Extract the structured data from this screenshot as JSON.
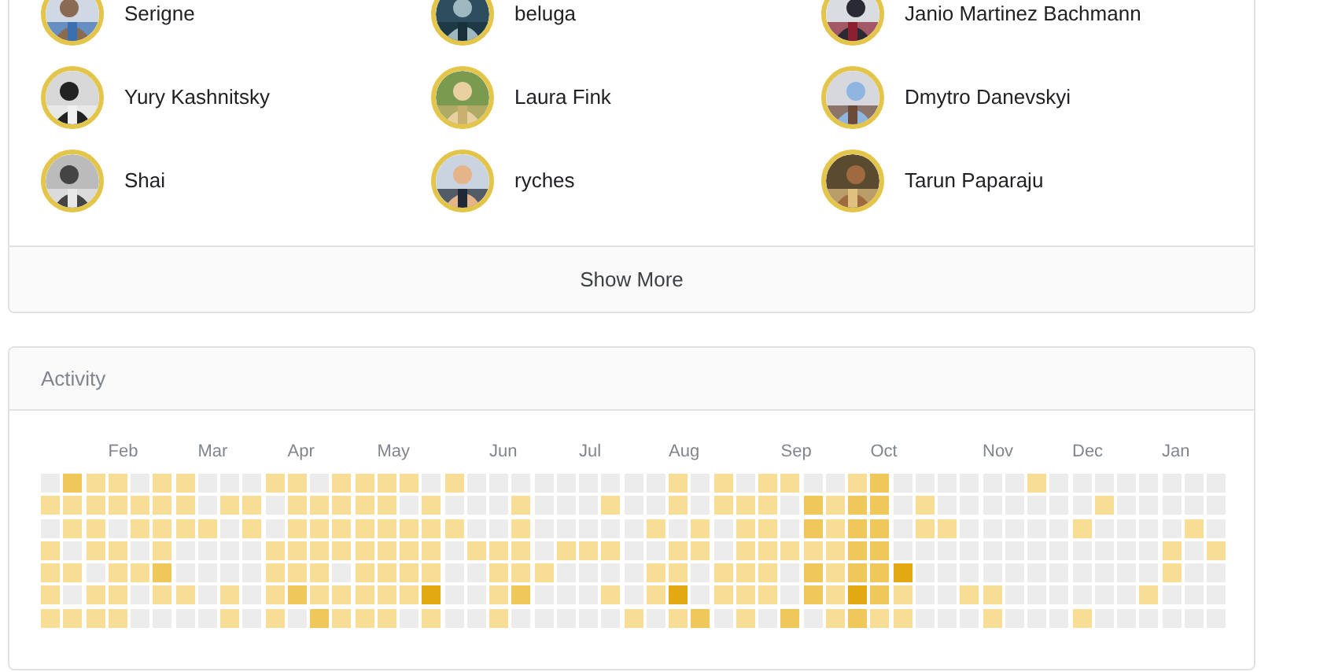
{
  "people": [
    {
      "name": "Serigne"
    },
    {
      "name": "beluga"
    },
    {
      "name": "Janio Martinez Bachmann"
    },
    {
      "name": "Yury Kashnitsky"
    },
    {
      "name": "Laura Fink"
    },
    {
      "name": "Dmytro Danevskyi"
    },
    {
      "name": "Shai"
    },
    {
      "name": "ryches"
    },
    {
      "name": "Tarun Paparaju"
    }
  ],
  "show_more": {
    "label": "Show More"
  },
  "activity": {
    "title": "Activity",
    "weeks": [
      {
        "days": [
          {
            "color": "#ececec"
          },
          {
            "color": "#f8dd97"
          },
          {
            "color": "#ececec"
          },
          {
            "color": "#f8dd97"
          },
          {
            "color": "#f8dd97"
          },
          {
            "color": "#f8dd97"
          },
          {
            "color": "#f8dd97"
          }
        ]
      },
      {
        "days": [
          {
            "color": "#f0c75a"
          },
          {
            "color": "#f8dd97"
          },
          {
            "color": "#f8dd97"
          },
          {
            "color": "#ececec"
          },
          {
            "color": "#f8dd97"
          },
          {
            "color": "#ececec"
          },
          {
            "color": "#f8dd97"
          }
        ]
      },
      {
        "days": [
          {
            "color": "#f8dd97"
          },
          {
            "color": "#f8dd97"
          },
          {
            "color": "#f8dd97"
          },
          {
            "color": "#f8dd97"
          },
          {
            "color": "#ececec"
          },
          {
            "color": "#f8dd97"
          },
          {
            "color": "#f8dd97"
          }
        ]
      },
      {
        "month": "Feb",
        "days": [
          {
            "color": "#f8dd97"
          },
          {
            "color": "#f8dd97"
          },
          {
            "color": "#ececec"
          },
          {
            "color": "#f8dd97"
          },
          {
            "color": "#f8dd97"
          },
          {
            "color": "#f8dd97"
          },
          {
            "color": "#f8dd97"
          }
        ]
      },
      {
        "days": [
          {
            "color": "#ececec"
          },
          {
            "color": "#f8dd97"
          },
          {
            "color": "#f8dd97"
          },
          {
            "color": "#ececec"
          },
          {
            "color": "#f8dd97"
          },
          {
            "color": "#ececec"
          },
          {
            "color": "#ececec"
          }
        ]
      },
      {
        "days": [
          {
            "color": "#f8dd97"
          },
          {
            "color": "#f8dd97"
          },
          {
            "color": "#f8dd97"
          },
          {
            "color": "#f8dd97"
          },
          {
            "color": "#f0c75a"
          },
          {
            "color": "#f8dd97"
          },
          {
            "color": "#ececec"
          }
        ]
      },
      {
        "days": [
          {
            "color": "#f8dd97"
          },
          {
            "color": "#f8dd97"
          },
          {
            "color": "#f8dd97"
          },
          {
            "color": "#ececec"
          },
          {
            "color": "#ececec"
          },
          {
            "color": "#f8dd97"
          },
          {
            "color": "#ececec"
          }
        ]
      },
      {
        "month": "Mar",
        "days": [
          {
            "color": "#ececec"
          },
          {
            "color": "#ececec"
          },
          {
            "color": "#f8dd97"
          },
          {
            "color": "#ececec"
          },
          {
            "color": "#ececec"
          },
          {
            "color": "#ececec"
          },
          {
            "color": "#ececec"
          }
        ]
      },
      {
        "days": [
          {
            "color": "#ececec"
          },
          {
            "color": "#f8dd97"
          },
          {
            "color": "#ececec"
          },
          {
            "color": "#ececec"
          },
          {
            "color": "#ececec"
          },
          {
            "color": "#f8dd97"
          },
          {
            "color": "#f8dd97"
          }
        ]
      },
      {
        "days": [
          {
            "color": "#ececec"
          },
          {
            "color": "#f8dd97"
          },
          {
            "color": "#f8dd97"
          },
          {
            "color": "#ececec"
          },
          {
            "color": "#ececec"
          },
          {
            "color": "#ececec"
          },
          {
            "color": "#ececec"
          }
        ]
      },
      {
        "days": [
          {
            "color": "#f8dd97"
          },
          {
            "color": "#ececec"
          },
          {
            "color": "#ececec"
          },
          {
            "color": "#f8dd97"
          },
          {
            "color": "#f8dd97"
          },
          {
            "color": "#f8dd97"
          },
          {
            "color": "#f8dd97"
          }
        ]
      },
      {
        "month": "Apr",
        "days": [
          {
            "color": "#f8dd97"
          },
          {
            "color": "#f8dd97"
          },
          {
            "color": "#f8dd97"
          },
          {
            "color": "#f8dd97"
          },
          {
            "color": "#f8dd97"
          },
          {
            "color": "#f0c75a"
          },
          {
            "color": "#ececec"
          }
        ]
      },
      {
        "days": [
          {
            "color": "#ececec"
          },
          {
            "color": "#f8dd97"
          },
          {
            "color": "#f8dd97"
          },
          {
            "color": "#f8dd97"
          },
          {
            "color": "#f8dd97"
          },
          {
            "color": "#f8dd97"
          },
          {
            "color": "#f0c75a"
          }
        ]
      },
      {
        "days": [
          {
            "color": "#f8dd97"
          },
          {
            "color": "#f8dd97"
          },
          {
            "color": "#f8dd97"
          },
          {
            "color": "#f8dd97"
          },
          {
            "color": "#ececec"
          },
          {
            "color": "#f8dd97"
          },
          {
            "color": "#f8dd97"
          }
        ]
      },
      {
        "days": [
          {
            "color": "#f8dd97"
          },
          {
            "color": "#f8dd97"
          },
          {
            "color": "#f8dd97"
          },
          {
            "color": "#f8dd97"
          },
          {
            "color": "#f8dd97"
          },
          {
            "color": "#f8dd97"
          },
          {
            "color": "#f8dd97"
          }
        ]
      },
      {
        "month": "May",
        "days": [
          {
            "color": "#f8dd97"
          },
          {
            "color": "#f8dd97"
          },
          {
            "color": "#f8dd97"
          },
          {
            "color": "#f8dd97"
          },
          {
            "color": "#f8dd97"
          },
          {
            "color": "#f8dd97"
          },
          {
            "color": "#f8dd97"
          }
        ]
      },
      {
        "days": [
          {
            "color": "#f8dd97"
          },
          {
            "color": "#ececec"
          },
          {
            "color": "#f8dd97"
          },
          {
            "color": "#f8dd97"
          },
          {
            "color": "#f8dd97"
          },
          {
            "color": "#f8dd97"
          },
          {
            "color": "#ececec"
          }
        ]
      },
      {
        "days": [
          {
            "color": "#ececec"
          },
          {
            "color": "#f8dd97"
          },
          {
            "color": "#f8dd97"
          },
          {
            "color": "#f8dd97"
          },
          {
            "color": "#f8dd97"
          },
          {
            "color": "#e2a912"
          },
          {
            "color": "#f8dd97"
          }
        ]
      },
      {
        "days": [
          {
            "color": "#f8dd97"
          },
          {
            "color": "#ececec"
          },
          {
            "color": "#f8dd97"
          },
          {
            "color": "#ececec"
          },
          {
            "color": "#ececec"
          },
          {
            "color": "#ececec"
          },
          {
            "color": "#ececec"
          }
        ]
      },
      {
        "days": [
          {
            "color": "#ececec"
          },
          {
            "color": "#ececec"
          },
          {
            "color": "#ececec"
          },
          {
            "color": "#f8dd97"
          },
          {
            "color": "#ececec"
          },
          {
            "color": "#ececec"
          },
          {
            "color": "#ececec"
          }
        ]
      },
      {
        "month": "Jun",
        "days": [
          {
            "color": "#ececec"
          },
          {
            "color": "#ececec"
          },
          {
            "color": "#ececec"
          },
          {
            "color": "#f8dd97"
          },
          {
            "color": "#f8dd97"
          },
          {
            "color": "#f8dd97"
          },
          {
            "color": "#f8dd97"
          }
        ]
      },
      {
        "days": [
          {
            "color": "#ececec"
          },
          {
            "color": "#f8dd97"
          },
          {
            "color": "#f8dd97"
          },
          {
            "color": "#f8dd97"
          },
          {
            "color": "#f8dd97"
          },
          {
            "color": "#f0c75a"
          },
          {
            "color": "#ececec"
          }
        ]
      },
      {
        "days": [
          {
            "color": "#ececec"
          },
          {
            "color": "#ececec"
          },
          {
            "color": "#ececec"
          },
          {
            "color": "#ececec"
          },
          {
            "color": "#f8dd97"
          },
          {
            "color": "#ececec"
          },
          {
            "color": "#ececec"
          }
        ]
      },
      {
        "days": [
          {
            "color": "#ececec"
          },
          {
            "color": "#ececec"
          },
          {
            "color": "#ececec"
          },
          {
            "color": "#f8dd97"
          },
          {
            "color": "#ececec"
          },
          {
            "color": "#ececec"
          },
          {
            "color": "#ececec"
          }
        ]
      },
      {
        "month": "Jul",
        "days": [
          {
            "color": "#ececec"
          },
          {
            "color": "#ececec"
          },
          {
            "color": "#ececec"
          },
          {
            "color": "#f8dd97"
          },
          {
            "color": "#ececec"
          },
          {
            "color": "#ececec"
          },
          {
            "color": "#ececec"
          }
        ]
      },
      {
        "days": [
          {
            "color": "#ececec"
          },
          {
            "color": "#f8dd97"
          },
          {
            "color": "#ececec"
          },
          {
            "color": "#f8dd97"
          },
          {
            "color": "#ececec"
          },
          {
            "color": "#f8dd97"
          },
          {
            "color": "#ececec"
          }
        ]
      },
      {
        "days": [
          {
            "color": "#ececec"
          },
          {
            "color": "#ececec"
          },
          {
            "color": "#ececec"
          },
          {
            "color": "#ececec"
          },
          {
            "color": "#ececec"
          },
          {
            "color": "#ececec"
          },
          {
            "color": "#f8dd97"
          }
        ]
      },
      {
        "days": [
          {
            "color": "#ececec"
          },
          {
            "color": "#ececec"
          },
          {
            "color": "#f8dd97"
          },
          {
            "color": "#ececec"
          },
          {
            "color": "#f8dd97"
          },
          {
            "color": "#f8dd97"
          },
          {
            "color": "#ececec"
          }
        ]
      },
      {
        "month": "Aug",
        "days": [
          {
            "color": "#f8dd97"
          },
          {
            "color": "#f8dd97"
          },
          {
            "color": "#ececec"
          },
          {
            "color": "#f8dd97"
          },
          {
            "color": "#f8dd97"
          },
          {
            "color": "#e2a912"
          },
          {
            "color": "#f8dd97"
          }
        ]
      },
      {
        "days": [
          {
            "color": "#ececec"
          },
          {
            "color": "#ececec"
          },
          {
            "color": "#f8dd97"
          },
          {
            "color": "#f8dd97"
          },
          {
            "color": "#ececec"
          },
          {
            "color": "#ececec"
          },
          {
            "color": "#f0c75a"
          }
        ]
      },
      {
        "days": [
          {
            "color": "#f8dd97"
          },
          {
            "color": "#f8dd97"
          },
          {
            "color": "#ececec"
          },
          {
            "color": "#ececec"
          },
          {
            "color": "#f8dd97"
          },
          {
            "color": "#f8dd97"
          },
          {
            "color": "#ececec"
          }
        ]
      },
      {
        "days": [
          {
            "color": "#ececec"
          },
          {
            "color": "#f8dd97"
          },
          {
            "color": "#f8dd97"
          },
          {
            "color": "#f8dd97"
          },
          {
            "color": "#f8dd97"
          },
          {
            "color": "#f8dd97"
          },
          {
            "color": "#f8dd97"
          }
        ]
      },
      {
        "days": [
          {
            "color": "#f8dd97"
          },
          {
            "color": "#f8dd97"
          },
          {
            "color": "#f8dd97"
          },
          {
            "color": "#f8dd97"
          },
          {
            "color": "#f8dd97"
          },
          {
            "color": "#f8dd97"
          },
          {
            "color": "#ececec"
          }
        ]
      },
      {
        "month": "Sep",
        "days": [
          {
            "color": "#f8dd97"
          },
          {
            "color": "#ececec"
          },
          {
            "color": "#ececec"
          },
          {
            "color": "#f8dd97"
          },
          {
            "color": "#ececec"
          },
          {
            "color": "#ececec"
          },
          {
            "color": "#f0c75a"
          }
        ]
      },
      {
        "days": [
          {
            "color": "#ececec"
          },
          {
            "color": "#f0c75a"
          },
          {
            "color": "#f0c75a"
          },
          {
            "color": "#f8dd97"
          },
          {
            "color": "#f0c75a"
          },
          {
            "color": "#f0c75a"
          },
          {
            "color": "#ececec"
          }
        ]
      },
      {
        "days": [
          {
            "color": "#ececec"
          },
          {
            "color": "#f8dd97"
          },
          {
            "color": "#f8dd97"
          },
          {
            "color": "#f8dd97"
          },
          {
            "color": "#f8dd97"
          },
          {
            "color": "#f8dd97"
          },
          {
            "color": "#f8dd97"
          }
        ]
      },
      {
        "days": [
          {
            "color": "#f8dd97"
          },
          {
            "color": "#f0c75a"
          },
          {
            "color": "#f0c75a"
          },
          {
            "color": "#f0c75a"
          },
          {
            "color": "#f0c75a"
          },
          {
            "color": "#e2a912"
          },
          {
            "color": "#f0c75a"
          }
        ]
      },
      {
        "month": "Oct",
        "days": [
          {
            "color": "#f0c75a"
          },
          {
            "color": "#f0c75a"
          },
          {
            "color": "#f0c75a"
          },
          {
            "color": "#f0c75a"
          },
          {
            "color": "#f0c75a"
          },
          {
            "color": "#f0c75a"
          },
          {
            "color": "#f8dd97"
          }
        ]
      },
      {
        "days": [
          {
            "color": "#ececec"
          },
          {
            "color": "#ececec"
          },
          {
            "color": "#ececec"
          },
          {
            "color": "#ececec"
          },
          {
            "color": "#e2a912"
          },
          {
            "color": "#f8dd97"
          },
          {
            "color": "#f8dd97"
          }
        ]
      },
      {
        "days": [
          {
            "color": "#ececec"
          },
          {
            "color": "#f8dd97"
          },
          {
            "color": "#f8dd97"
          },
          {
            "color": "#ececec"
          },
          {
            "color": "#ececec"
          },
          {
            "color": "#ececec"
          },
          {
            "color": "#ececec"
          }
        ]
      },
      {
        "days": [
          {
            "color": "#ececec"
          },
          {
            "color": "#ececec"
          },
          {
            "color": "#f8dd97"
          },
          {
            "color": "#ececec"
          },
          {
            "color": "#ececec"
          },
          {
            "color": "#ececec"
          },
          {
            "color": "#ececec"
          }
        ]
      },
      {
        "days": [
          {
            "color": "#ececec"
          },
          {
            "color": "#ececec"
          },
          {
            "color": "#ececec"
          },
          {
            "color": "#ececec"
          },
          {
            "color": "#ececec"
          },
          {
            "color": "#f8dd97"
          },
          {
            "color": "#ececec"
          }
        ]
      },
      {
        "month": "Nov",
        "days": [
          {
            "color": "#ececec"
          },
          {
            "color": "#ececec"
          },
          {
            "color": "#ececec"
          },
          {
            "color": "#ececec"
          },
          {
            "color": "#ececec"
          },
          {
            "color": "#f8dd97"
          },
          {
            "color": "#f8dd97"
          }
        ]
      },
      {
        "days": [
          {
            "color": "#ececec"
          },
          {
            "color": "#ececec"
          },
          {
            "color": "#ececec"
          },
          {
            "color": "#ececec"
          },
          {
            "color": "#ececec"
          },
          {
            "color": "#ececec"
          },
          {
            "color": "#ececec"
          }
        ]
      },
      {
        "days": [
          {
            "color": "#f8dd97"
          },
          {
            "color": "#ececec"
          },
          {
            "color": "#ececec"
          },
          {
            "color": "#ececec"
          },
          {
            "color": "#ececec"
          },
          {
            "color": "#ececec"
          },
          {
            "color": "#ececec"
          }
        ]
      },
      {
        "days": [
          {
            "color": "#ececec"
          },
          {
            "color": "#ececec"
          },
          {
            "color": "#ececec"
          },
          {
            "color": "#ececec"
          },
          {
            "color": "#ececec"
          },
          {
            "color": "#ececec"
          },
          {
            "color": "#ececec"
          }
        ]
      },
      {
        "month": "Dec",
        "days": [
          {
            "color": "#ececec"
          },
          {
            "color": "#ececec"
          },
          {
            "color": "#f8dd97"
          },
          {
            "color": "#ececec"
          },
          {
            "color": "#ececec"
          },
          {
            "color": "#ececec"
          },
          {
            "color": "#f8dd97"
          }
        ]
      },
      {
        "days": [
          {
            "color": "#ececec"
          },
          {
            "color": "#f8dd97"
          },
          {
            "color": "#ececec"
          },
          {
            "color": "#ececec"
          },
          {
            "color": "#ececec"
          },
          {
            "color": "#ececec"
          },
          {
            "color": "#ececec"
          }
        ]
      },
      {
        "days": [
          {
            "color": "#ececec"
          },
          {
            "color": "#ececec"
          },
          {
            "color": "#ececec"
          },
          {
            "color": "#ececec"
          },
          {
            "color": "#ececec"
          },
          {
            "color": "#ececec"
          },
          {
            "color": "#ececec"
          }
        ]
      },
      {
        "days": [
          {
            "color": "#ececec"
          },
          {
            "color": "#ececec"
          },
          {
            "color": "#ececec"
          },
          {
            "color": "#ececec"
          },
          {
            "color": "#ececec"
          },
          {
            "color": "#f8dd97"
          },
          {
            "color": "#ececec"
          }
        ]
      },
      {
        "month": "Jan",
        "days": [
          {
            "color": "#ececec"
          },
          {
            "color": "#ececec"
          },
          {
            "color": "#ececec"
          },
          {
            "color": "#f8dd97"
          },
          {
            "color": "#f8dd97"
          },
          {
            "color": "#ececec"
          },
          {
            "color": "#ececec"
          }
        ]
      },
      {
        "days": [
          {
            "color": "#ececec"
          },
          {
            "color": "#ececec"
          },
          {
            "color": "#f8dd97"
          },
          {
            "color": "#ececec"
          },
          {
            "color": "#ececec"
          },
          {
            "color": "#ececec"
          },
          {
            "color": "#ececec"
          }
        ]
      },
      {
        "days": [
          {
            "color": "#ececec"
          },
          {
            "color": "#ececec"
          },
          {
            "color": "#ececec"
          },
          {
            "color": "#f8dd97"
          },
          {
            "color": "#ececec"
          },
          {
            "color": "#ececec"
          },
          {
            "color": "#ececec"
          }
        ]
      }
    ]
  }
}
